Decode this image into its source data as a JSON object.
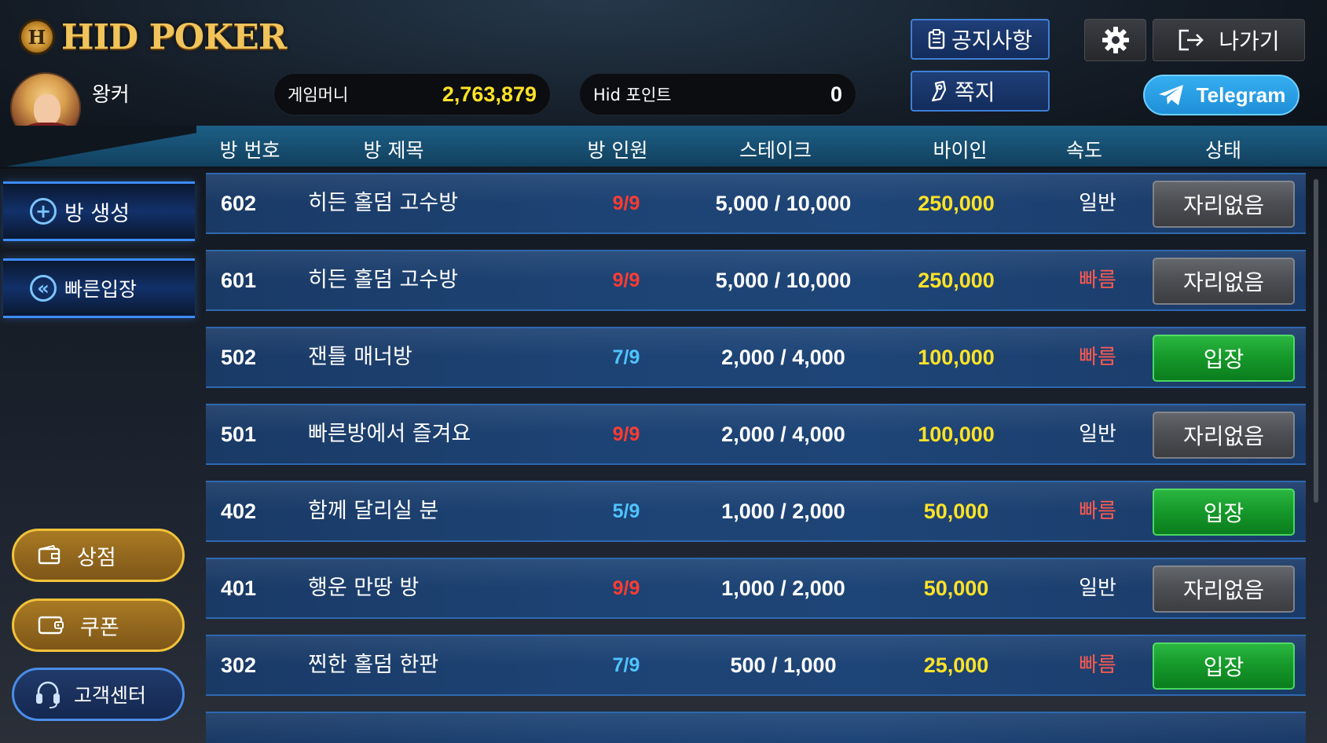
{
  "app": {
    "logo_text": "HID POKER",
    "logo_chip": "H"
  },
  "user": {
    "name": "왕커"
  },
  "wallet": {
    "game_money_label": "게임머니",
    "game_money_value": "2,763,879",
    "game_money_color": "#ffe227",
    "hid_points_label": "Hid 포인트",
    "hid_points_value": "0"
  },
  "top_buttons": {
    "notice": "공지사항",
    "message": "쪽지",
    "settings_icon": "gear-icon",
    "exit": "나가기",
    "telegram": "Telegram"
  },
  "columns": {
    "room_no": "방 번호",
    "room_title": "방 제목",
    "players": "방 인원",
    "stake": "스테이크",
    "buyin": "바이인",
    "speed": "속도",
    "status": "상태"
  },
  "sidebar": {
    "create_room": "방 생성",
    "quick_join": "빠른입장",
    "shop": "상점",
    "coupon": "쿠폰",
    "support": "고객센터"
  },
  "colors": {
    "full_players": "#ff3b30",
    "open_players": "#4fc3ff",
    "fast_speed": "#ff5a4e",
    "normal_speed": "#ffffff",
    "buyin": "#ffe227",
    "enter_button": "#1aa030",
    "full_button": "#4a4d52"
  },
  "rooms": [
    {
      "no": "602",
      "title": "히든 홀덤 고수방",
      "players": "9/9",
      "full": true,
      "stake": "5,000 / 10,000",
      "buyin": "250,000",
      "speed": "일반",
      "fast": false,
      "status": "자리없음"
    },
    {
      "no": "601",
      "title": "히든 홀덤 고수방",
      "players": "9/9",
      "full": true,
      "stake": "5,000 / 10,000",
      "buyin": "250,000",
      "speed": "빠름",
      "fast": true,
      "status": "자리없음"
    },
    {
      "no": "502",
      "title": "잰틀 매너방",
      "players": "7/9",
      "full": false,
      "stake": "2,000 / 4,000",
      "buyin": "100,000",
      "speed": "빠름",
      "fast": true,
      "status": "입장"
    },
    {
      "no": "501",
      "title": "빠른방에서 즐겨요",
      "players": "9/9",
      "full": true,
      "stake": "2,000 / 4,000",
      "buyin": "100,000",
      "speed": "일반",
      "fast": false,
      "status": "자리없음"
    },
    {
      "no": "402",
      "title": "함께 달리실 분",
      "players": "5/9",
      "full": false,
      "stake": "1,000 / 2,000",
      "buyin": "50,000",
      "speed": "빠름",
      "fast": true,
      "status": "입장"
    },
    {
      "no": "401",
      "title": "행운 만땅 방",
      "players": "9/9",
      "full": true,
      "stake": "1,000 / 2,000",
      "buyin": "50,000",
      "speed": "일반",
      "fast": false,
      "status": "자리없음"
    },
    {
      "no": "302",
      "title": "찐한 홀덤 한판",
      "players": "7/9",
      "full": false,
      "stake": "500 / 1,000",
      "buyin": "25,000",
      "speed": "빠름",
      "fast": true,
      "status": "입장"
    }
  ]
}
